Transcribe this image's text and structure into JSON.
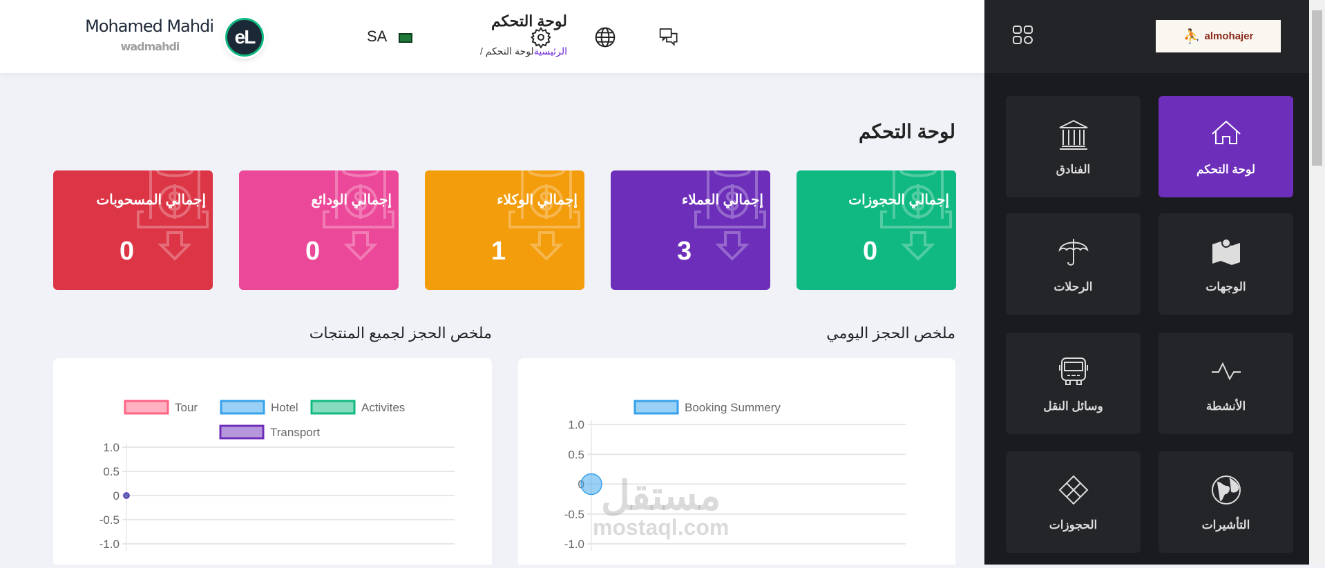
{
  "header": {
    "user_name": "Mohamed Mahdi",
    "username": "wadmahdi",
    "avatar_text": "eL",
    "language": "SA",
    "page_title": "لوحة التحكم",
    "breadcrumb_home": "الرئيسية",
    "breadcrumb_current": "لوحة التحكم",
    "breadcrumb_sep": "/"
  },
  "sidebar": {
    "logo_text": "almohajer",
    "items": [
      {
        "label": "لوحة التحكم",
        "icon": "home-icon",
        "active": true
      },
      {
        "label": "الفنادق",
        "icon": "bank-icon"
      },
      {
        "label": "الوجهات",
        "icon": "map-icon"
      },
      {
        "label": "الرحلات",
        "icon": "umbrella-icon"
      },
      {
        "label": "الأنشطة",
        "icon": "activity-icon"
      },
      {
        "label": "وسائل النقل",
        "icon": "bus-icon"
      },
      {
        "label": "التأشيرات",
        "icon": "globe-icon"
      },
      {
        "label": "الحجوزات",
        "icon": "diamond-grid-icon"
      }
    ]
  },
  "main": {
    "title": "لوحة التحكم",
    "cards": [
      {
        "label": "إجمالي الحجوزات",
        "value": "0",
        "color": "#10b981"
      },
      {
        "label": "إجمالي العملاء",
        "value": "3",
        "color": "#6d2fba"
      },
      {
        "label": "إجمالي الوكلاء",
        "value": "1",
        "color": "#f39c0c"
      },
      {
        "label": "إجمالي الودائع",
        "value": "0",
        "color": "#ec4899"
      },
      {
        "label": "إجمالي المسحوبات",
        "value": "0",
        "color": "#dc3545"
      }
    ],
    "daily_title": "ملخص الحجز اليومي",
    "products_title": "ملخص الحجز لجميع المنتجات"
  },
  "watermark": {
    "ar": "مستقل",
    "en": "mostaql.com"
  },
  "chart_data": [
    {
      "type": "line",
      "title": "ملخص الحجز اليومي",
      "series": [
        {
          "name": "Booking Summery",
          "color": "#36a2eb",
          "values": [
            0
          ]
        }
      ],
      "yticks": [
        "1.0",
        "0.5",
        "0",
        "-0.5",
        "-1.0"
      ],
      "ylim": [
        -1,
        1
      ],
      "grid": true,
      "legend": "top"
    },
    {
      "type": "line",
      "title": "ملخص الحجز لجميع المنتجات",
      "series": [
        {
          "name": "Tour",
          "color": "#ff6384",
          "values": [
            0
          ]
        },
        {
          "name": "Hotel",
          "color": "#36a2eb",
          "values": [
            0
          ]
        },
        {
          "name": "Activites",
          "color": "#10b981",
          "values": [
            0
          ]
        },
        {
          "name": "Transport",
          "color": "#6d2fba",
          "values": [
            0
          ]
        }
      ],
      "yticks": [
        "1.0",
        "0.5",
        "0",
        "-0.5",
        "-1.0"
      ],
      "ylim": [
        -1,
        1
      ],
      "grid": true,
      "legend": "top"
    }
  ]
}
